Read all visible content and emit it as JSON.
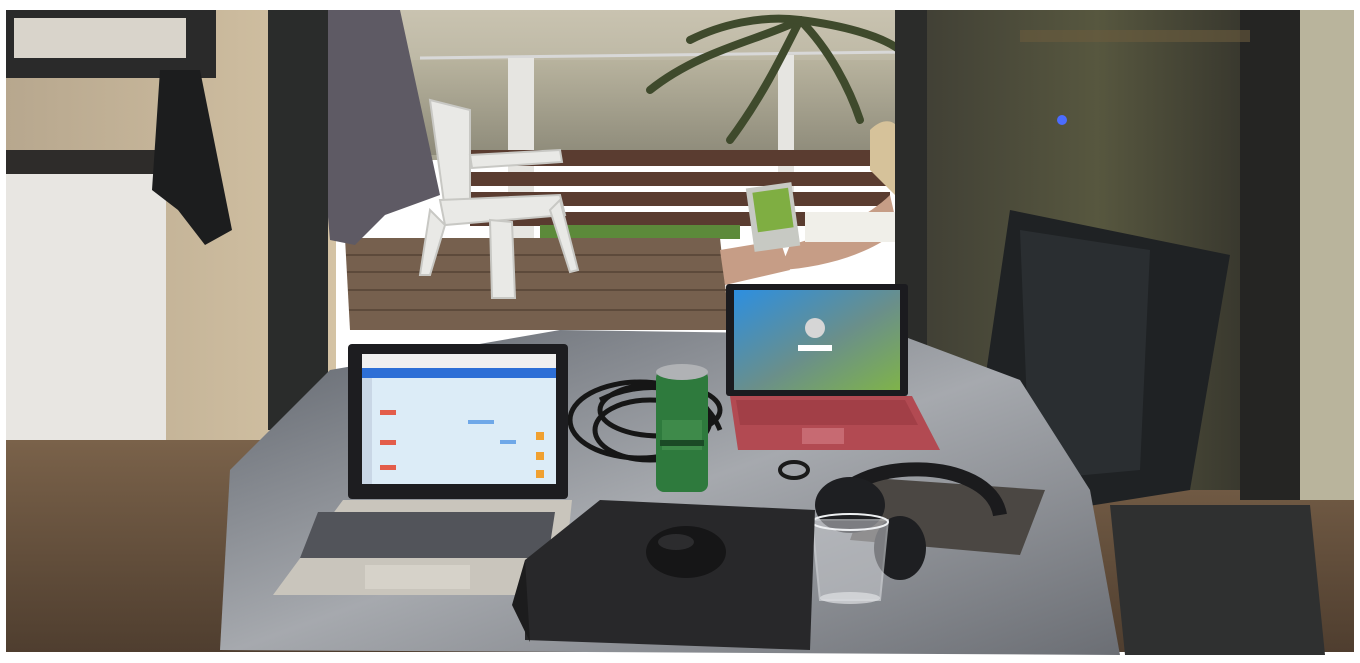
{
  "scene": {
    "type": "photograph",
    "colors": {
      "sky": "#b9b6a6",
      "sea": "#a9a691",
      "wall": "#c9b79a",
      "floor": "#6b5440",
      "deck": "#6f5c4c",
      "table": "#8a8c92",
      "laptop_screen_blue": "#2a8bd8",
      "laptop_red": "#b64d55",
      "can_green": "#2e7a3d",
      "pad_dark": "#2b2b2d"
    },
    "objects": [
      "kitchen-counter",
      "hanging-towel",
      "curtain",
      "balcony-railing",
      "palm-tree",
      "white-plastic-chair",
      "wooden-deck",
      "person-with-laptop",
      "glass-door-reflection",
      "dark-chair",
      "round-table",
      "silver-laptop",
      "red-tablet-laptop",
      "beer-can",
      "cable-bundle",
      "headphones",
      "water-glass",
      "laptop-sleeve",
      "computer-mouse",
      "notebook",
      "floor-mat"
    ]
  }
}
